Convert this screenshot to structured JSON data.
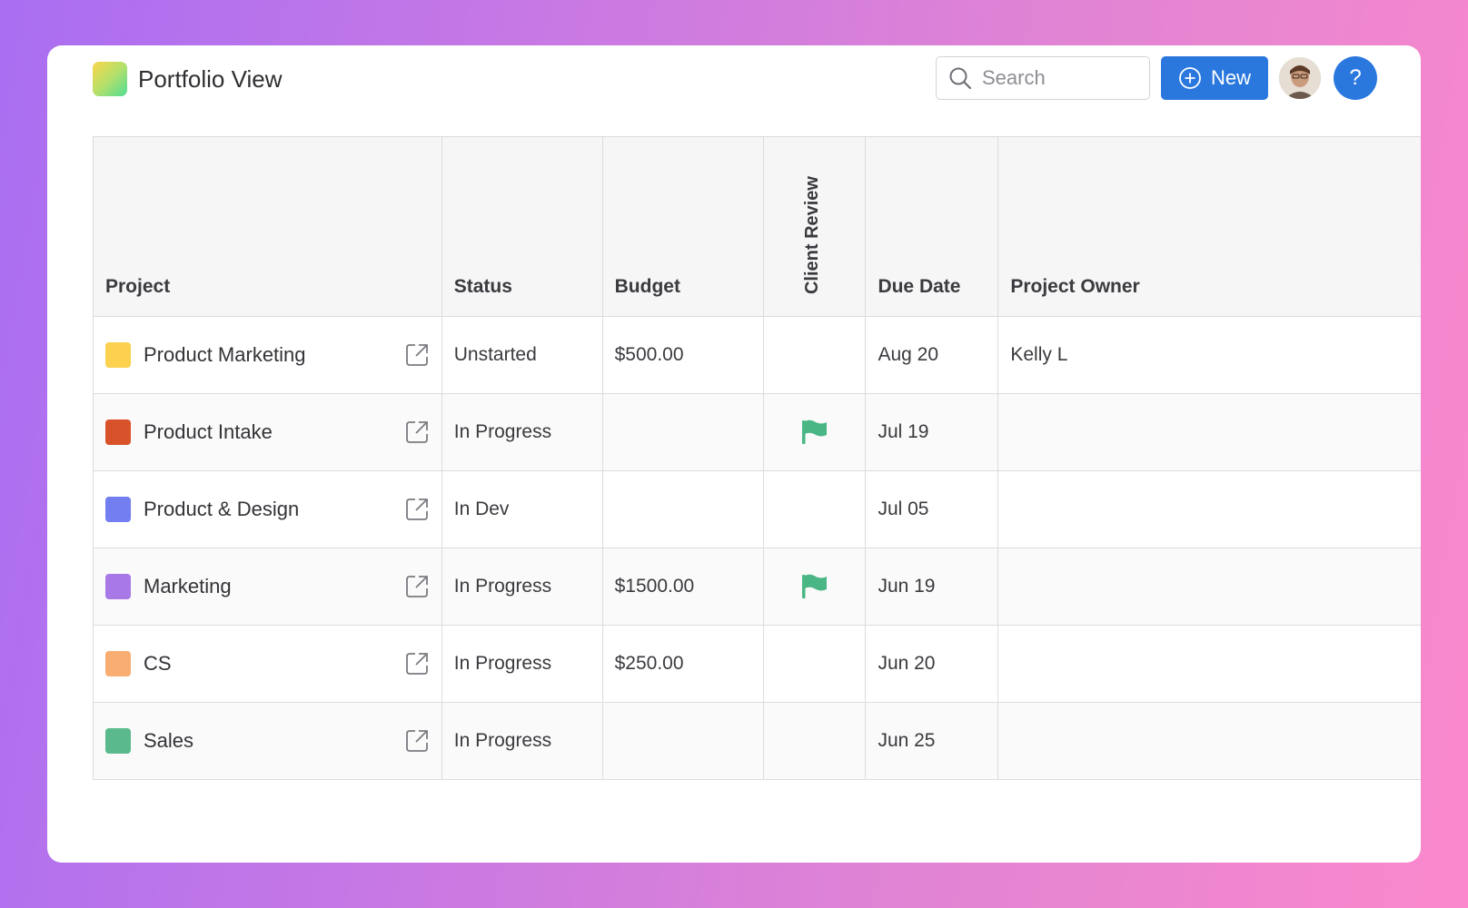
{
  "header": {
    "title": "Portfolio View",
    "search_placeholder": "Search",
    "new_label": "New",
    "help_label": "?"
  },
  "colors": {
    "accent": "#2a78de",
    "flag": "#4bb685"
  },
  "table": {
    "columns": [
      "Project",
      "Status",
      "Budget",
      "Client Review",
      "Due Date",
      "Project Owner"
    ],
    "rows": [
      {
        "project": "Product Marketing",
        "color": "#fbd14f",
        "status": "Unstarted",
        "budget": "$500.00",
        "client_review": false,
        "due": "Aug 20",
        "owner": "Kelly L"
      },
      {
        "project": "Product Intake",
        "color": "#d8522a",
        "status": "In Progress",
        "budget": "",
        "client_review": true,
        "due": "Jul 19",
        "owner": ""
      },
      {
        "project": "Product & Design",
        "color": "#737ef0",
        "status": "In Dev",
        "budget": "",
        "client_review": false,
        "due": "Jul 05",
        "owner": ""
      },
      {
        "project": "Marketing",
        "color": "#a879e6",
        "status": "In Progress",
        "budget": "$1500.00",
        "client_review": true,
        "due": "Jun 19",
        "owner": ""
      },
      {
        "project": "CS",
        "color": "#f8ad72",
        "status": "In Progress",
        "budget": "$250.00",
        "client_review": false,
        "due": "Jun 20",
        "owner": ""
      },
      {
        "project": "Sales",
        "color": "#5ab98d",
        "status": "In Progress",
        "budget": "",
        "client_review": false,
        "due": "Jun 25",
        "owner": ""
      }
    ]
  }
}
